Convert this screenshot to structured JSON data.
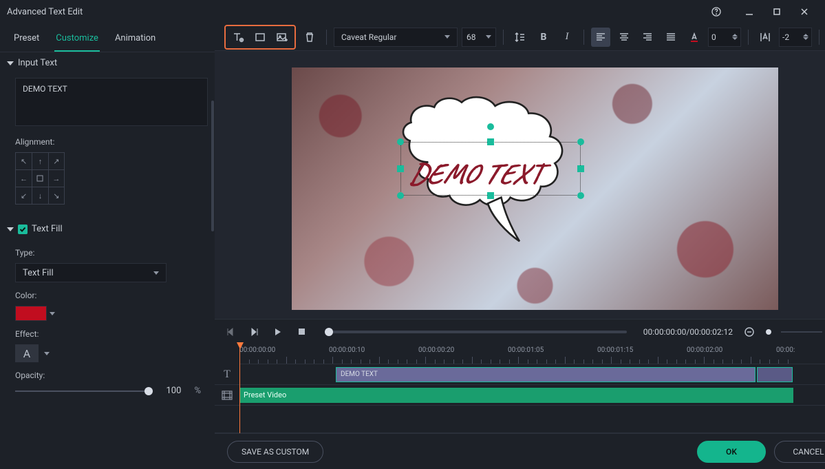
{
  "window": {
    "title": "Advanced Text Edit"
  },
  "tabs": {
    "preset": "Preset",
    "customize": "Customize",
    "animation": "Animation",
    "active": "customize"
  },
  "sidebar": {
    "input_section": "Input Text",
    "text_value": "DEMO TEXT",
    "alignment_label": "Alignment:",
    "textfill_section": "Text Fill",
    "textfill_checked": true,
    "type_label": "Type:",
    "type_value": "Text Fill",
    "color_label": "Color:",
    "color_value": "#c10d1f",
    "effect_label": "Effect:",
    "effect_glyph": "A",
    "opacity_label": "Opacity:",
    "opacity_value": "100",
    "opacity_unit": "%"
  },
  "toolbar": {
    "font": "Caveat Regular",
    "size": "68",
    "char_spacing": "0",
    "line_spacing": "-2"
  },
  "preview": {
    "demo_text": "DEMO TEXT"
  },
  "transport": {
    "timecode": "00:00:00:00/00:00:02:12"
  },
  "timeline": {
    "labels": [
      "00:00:00:00",
      "00:00:00:10",
      "00:00:00:20",
      "00:00:01:05",
      "00:00:01:15",
      "00:00:02:00",
      "00:00:"
    ],
    "text_clip": "DEMO TEXT",
    "video_clip": "Preset Video"
  },
  "footer": {
    "save_custom": "SAVE AS CUSTOM",
    "ok": "OK",
    "cancel": "CANCEL"
  }
}
